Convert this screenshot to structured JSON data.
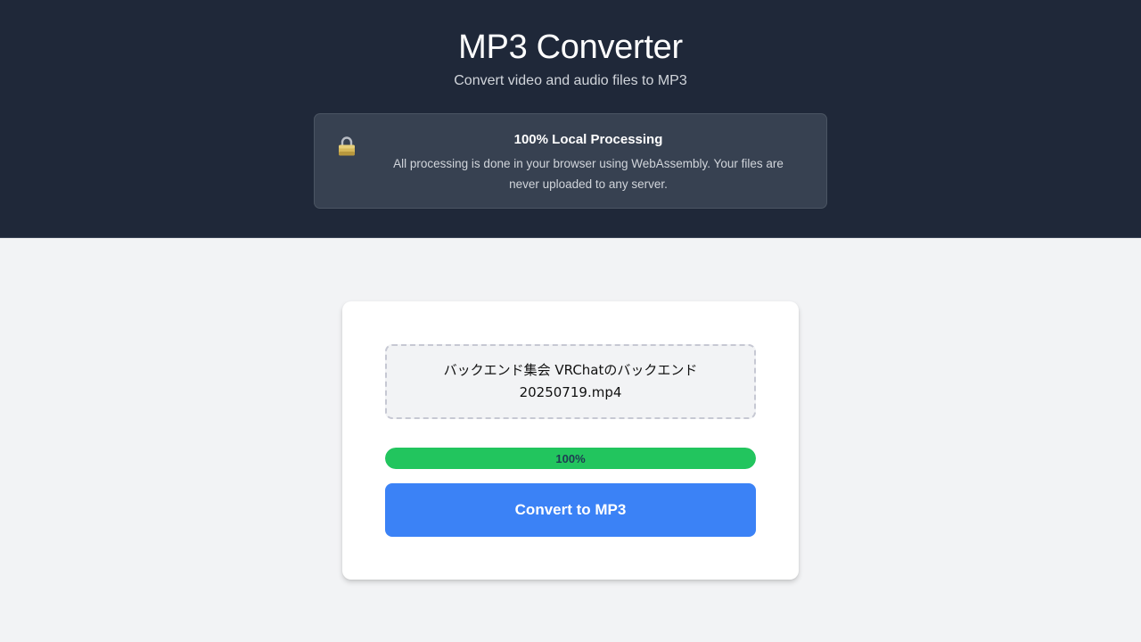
{
  "header": {
    "title": "MP3 Converter",
    "subtitle": "Convert video and audio files to MP3"
  },
  "notice": {
    "icon": "lock-icon",
    "title": "100% Local Processing",
    "body": "All processing is done in your browser using WebAssembly. Your files are never uploaded to any server."
  },
  "converter": {
    "file_name": "バックエンド集会 VRChatのバックエンド 20250719.mp4",
    "progress": {
      "value_percent": 100,
      "label": "100%"
    },
    "convert_label": "Convert to MP3"
  },
  "colors": {
    "header_bg": "#1f2839",
    "page_bg": "#f2f3f5",
    "progress_fill": "#22c55e",
    "button_bg": "#3b82f6"
  }
}
